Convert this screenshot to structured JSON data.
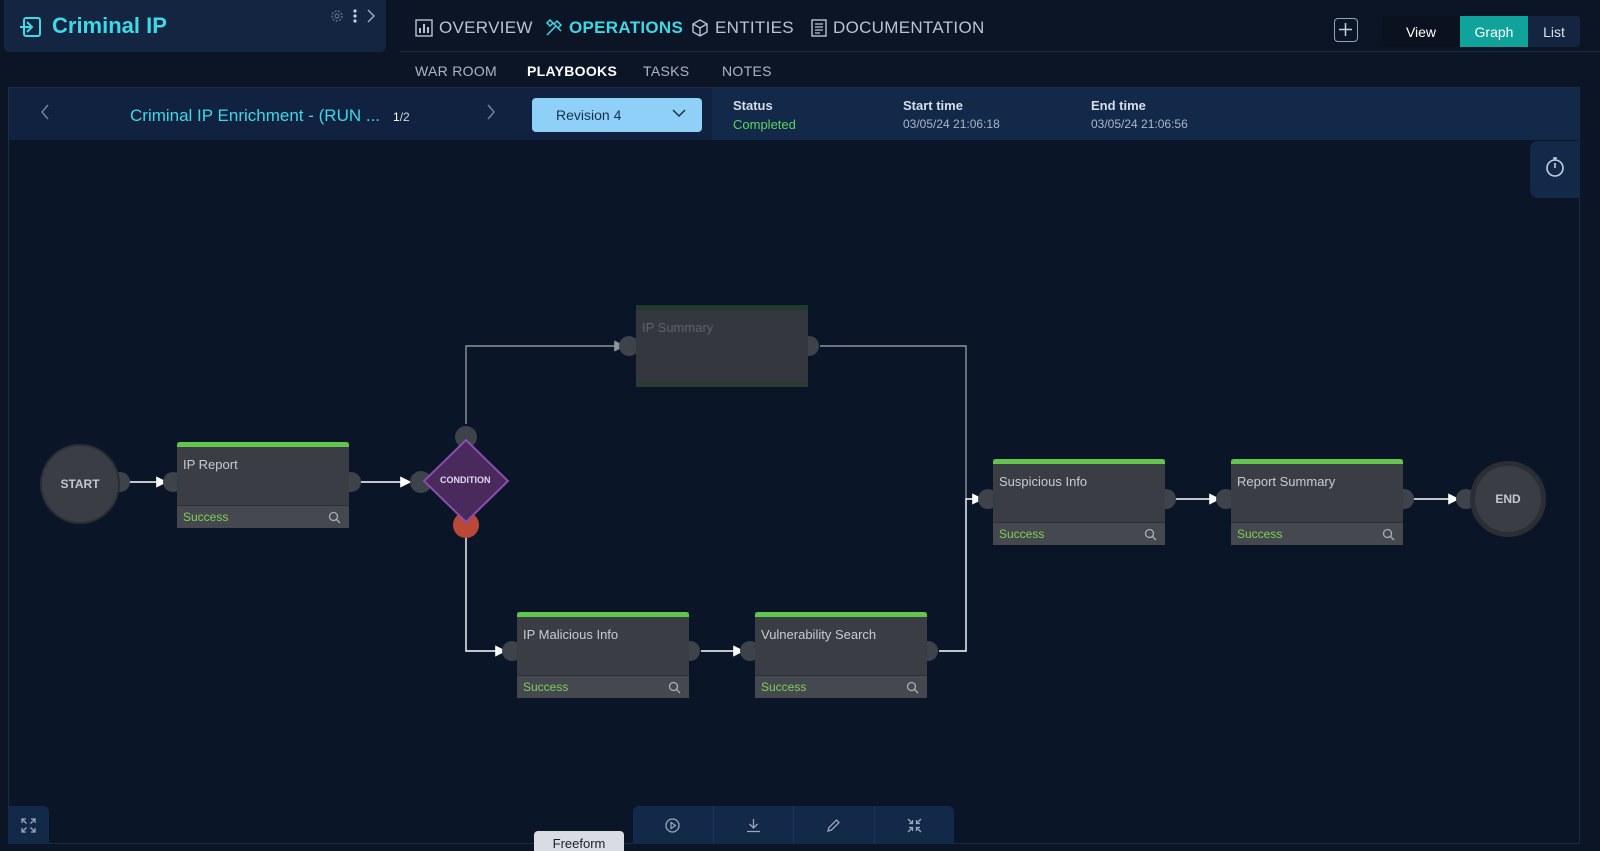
{
  "app": {
    "title": "Criminal IP"
  },
  "nav": {
    "tabs": [
      {
        "label": "OVERVIEW",
        "icon": "chart-icon"
      },
      {
        "label": "OPERATIONS",
        "icon": "tools-icon"
      },
      {
        "label": "ENTITIES",
        "icon": "cube-icon"
      },
      {
        "label": "DOCUMENTATION",
        "icon": "document-icon"
      }
    ],
    "subtabs": [
      "WAR ROOM",
      "PLAYBOOKS",
      "TASKS",
      "NOTES"
    ]
  },
  "view_toggle": {
    "label": "View",
    "graph": "Graph",
    "list": "List"
  },
  "playbook": {
    "name": "Criminal IP Enrichment - (RUN ...",
    "index": "1",
    "total": "/2",
    "revision": "Revision 4",
    "status_label": "Status",
    "status_value": "Completed",
    "start_label": "Start time",
    "start_value": "03/05/24 21:06:18",
    "end_label": "End time",
    "end_value": "03/05/24 21:06:56"
  },
  "graph": {
    "start": "START",
    "end": "END",
    "condition": "CONDITION",
    "tasks": [
      {
        "title": "IP Report",
        "status": "Success"
      },
      {
        "title": "IP Summary",
        "status": ""
      },
      {
        "title": "IP Malicious Info",
        "status": "Success"
      },
      {
        "title": "Vulnerability Search",
        "status": "Success"
      },
      {
        "title": "Suspicious Info",
        "status": "Success"
      },
      {
        "title": "Report Summary",
        "status": "Success"
      }
    ]
  },
  "bottom": {
    "freeform": "Freeform"
  },
  "colors": {
    "accent": "#3fd8e6",
    "success": "#62c64c",
    "graph_toggle": "#0fa39b",
    "revision": "#8fd0f8"
  }
}
